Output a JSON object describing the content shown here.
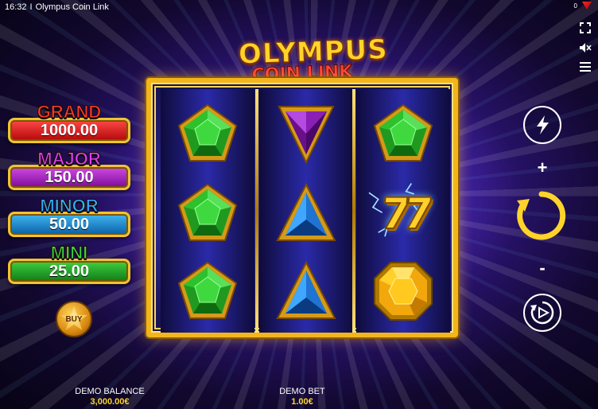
{
  "header": {
    "time": "16:32",
    "separator": "I",
    "title": "Olympus Coin Link",
    "brand_counter": "0"
  },
  "game_logo": {
    "line1": "OLYMPUS",
    "line2": "COIN LINK"
  },
  "jackpots": [
    {
      "name": "GRAND",
      "value": "1000.00",
      "color": "#ff3a2a"
    },
    {
      "name": "MAJOR",
      "value": "150.00",
      "color": "#e23ff5"
    },
    {
      "name": "MINOR",
      "value": "50.00",
      "color": "#2fb4ff"
    },
    {
      "name": "MINI",
      "value": "25.00",
      "color": "#3cd93c"
    }
  ],
  "buy_button": {
    "label": "BUY"
  },
  "reels": [
    [
      "green-gem",
      "green-gem",
      "green-gem"
    ],
    [
      "purple-triangle-gem",
      "blue-triangle-gem",
      "blue-triangle-gem"
    ],
    [
      "green-gem",
      "lucky-seven",
      "yellow-gem"
    ]
  ],
  "symbols": {
    "seven": "77"
  },
  "controls": {
    "plus": "+",
    "minus": "-",
    "icons": [
      "fullscreen-icon",
      "sound-off-icon",
      "menu-icon",
      "turbo-icon",
      "spin-icon",
      "autoplay-icon"
    ]
  },
  "footer": {
    "balance_label": "DEMO BALANCE",
    "balance_value": "3,000.00€",
    "bet_label": "DEMO BET",
    "bet_value": "1.00€"
  },
  "colors": {
    "frame_gold": "#f2b51c",
    "reel_bg": "#2a2aa8",
    "accent_yellow": "#ffd42a"
  }
}
